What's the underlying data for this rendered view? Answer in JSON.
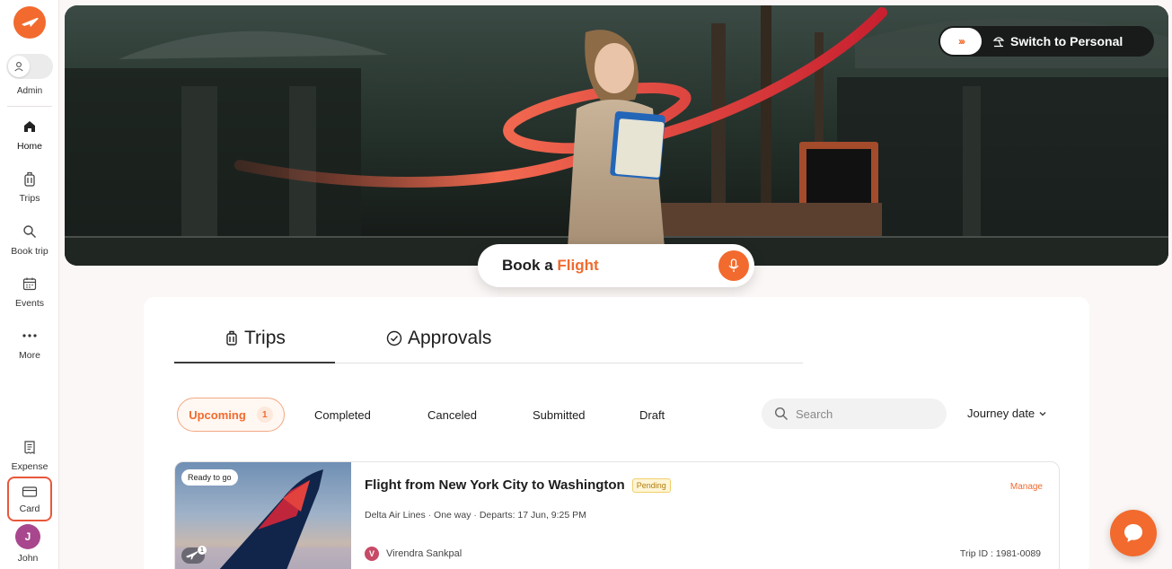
{
  "colors": {
    "accent": "#f26a2e",
    "card_outline": "#e8573b"
  },
  "sidebar": {
    "admin_label": "Admin",
    "items": [
      {
        "label": "Home",
        "icon": "home-icon"
      },
      {
        "label": "Trips",
        "icon": "luggage-icon"
      },
      {
        "label": "Book trip",
        "icon": "search-icon"
      },
      {
        "label": "Events",
        "icon": "calendar-icon"
      },
      {
        "label": "More",
        "icon": "more-dots-icon"
      }
    ],
    "bottom_items": [
      {
        "label": "Expense",
        "icon": "receipt-icon"
      },
      {
        "label": "Card",
        "icon": "credit-card-icon"
      }
    ],
    "user": {
      "initial": "J",
      "name": "John"
    }
  },
  "hero": {
    "switch_label": "Switch to Personal",
    "switch_chevrons": "›››",
    "book_prefix": "Book a ",
    "book_accent": "Flight"
  },
  "main": {
    "tabs": [
      {
        "label": "Trips",
        "icon": "luggage-icon"
      },
      {
        "label": "Approvals",
        "icon": "check-circle-icon"
      }
    ],
    "filters": [
      {
        "label": "Upcoming",
        "count": "1"
      },
      {
        "label": "Completed"
      },
      {
        "label": "Canceled"
      },
      {
        "label": "Submitted"
      },
      {
        "label": "Draft"
      }
    ],
    "search_placeholder": "Search",
    "sort_label": "Journey date"
  },
  "trip": {
    "badge": "Ready to go",
    "title": "Flight from New York City to Washington",
    "status": "Pending",
    "airline": "Delta Air Lines",
    "trip_type": "One way",
    "departs": "Departs: 17 Jun, 9:25 PM",
    "manage_label": "Manage",
    "traveler_initial": "V",
    "traveler_name": "Virendra Sankpal",
    "trip_id": "Trip ID : 1981-0089",
    "flight_badge_count": "1"
  }
}
